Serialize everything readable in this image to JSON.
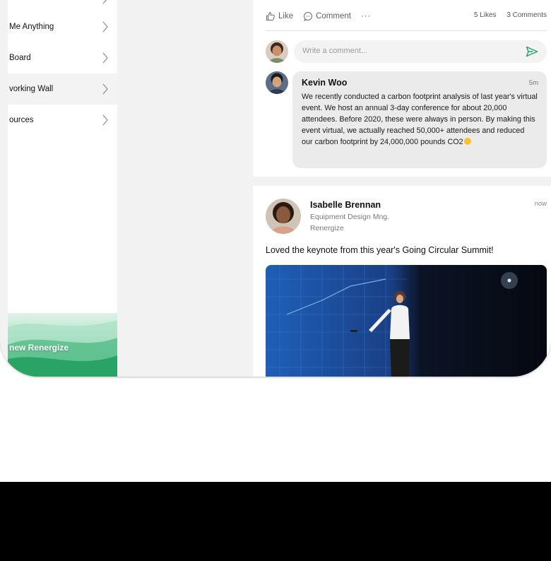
{
  "sidebar": {
    "items": [
      {
        "label": "Me Anything"
      },
      {
        "label": "Board"
      },
      {
        "label": "vorking Wall"
      },
      {
        "label": "ources"
      }
    ],
    "promo_label": "new Renergize"
  },
  "post1": {
    "actions": {
      "like_label": "Like",
      "comment_label": "Comment",
      "more_label": "···"
    },
    "counts": {
      "likes": "5 Likes",
      "comments": "3 Comments"
    },
    "comment_input": {
      "placeholder": "Write a comment..."
    },
    "comment": {
      "author": "Kevin Woo",
      "time": "5m",
      "text": "We recently conducted a carbon footprint analysis of last year's virtual event. We host an annual 3-day conference for about 20,000 attendees. Before 2020, these were always in person. By making this event virtual, we actually reached 50,000+ attendees and reduced our carbon footprint by 24,000,000 pounds CO2"
    }
  },
  "post2": {
    "author": "Isabelle Brennan",
    "role": "Equipment Design Mng.",
    "org": "Renergize",
    "time": "now",
    "text": "Loved the keynote from this year's Going Circular Summit!"
  },
  "colors": {
    "accent": "#1aa36b",
    "background": "#f2f2f2",
    "card": "#ffffff"
  }
}
